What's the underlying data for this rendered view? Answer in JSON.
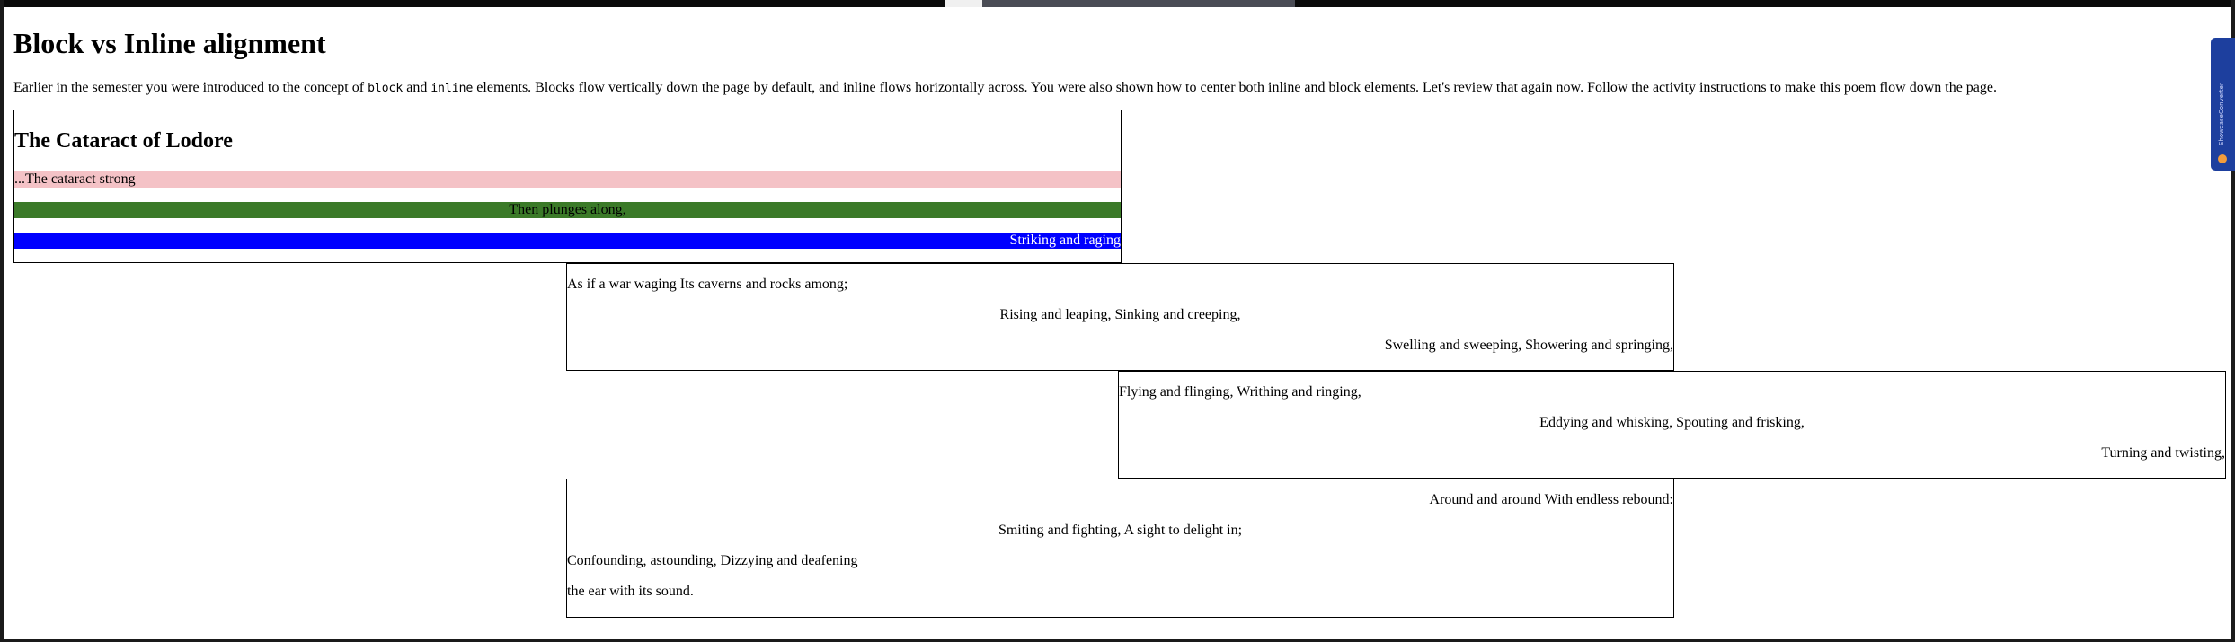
{
  "page": {
    "title": "Block vs Inline alignment",
    "intro": {
      "before_block": "Earlier in the semester you were introduced to the concept of ",
      "block_code": "block",
      "between": " and ",
      "inline_code": "inline",
      "after": " elements. Blocks flow vertically down the page by default, and inline flows horizontally across. You were also shown how to center both inline and block elements. Let's review that again now. Follow the activity instructions to make this poem flow down the page."
    }
  },
  "poem": {
    "title": "The Cataract of Lodore",
    "bars": {
      "pink": "...The cataract strong",
      "green": "Then plunges along,",
      "blue": "Striking and raging"
    },
    "stanza_1": {
      "line_1": "As if a war waging Its caverns and rocks among;",
      "line_2": "Rising and leaping, Sinking and creeping,",
      "line_3": "Swelling and sweeping, Showering and springing,"
    },
    "stanza_2": {
      "line_1": "Flying and flinging, Writhing and ringing,",
      "line_2": "Eddying and whisking, Spouting and frisking,",
      "line_3": "Turning and twisting,"
    },
    "stanza_3": {
      "line_1": "Around and around With endless rebound:",
      "line_2": "Smiting and fighting, A sight to delight in;",
      "line_3": "Confounding, astounding, Dizzying and deafening",
      "line_4": "the ear with its sound."
    }
  },
  "extension": {
    "label": "ShowcaseConverter",
    "icon": "extension-icon",
    "color": "#1d3f9e"
  },
  "colors": {
    "pink_bar": "#f4c2c6",
    "green_bar": "#3b7a28",
    "blue_bar": "#0000ff"
  }
}
